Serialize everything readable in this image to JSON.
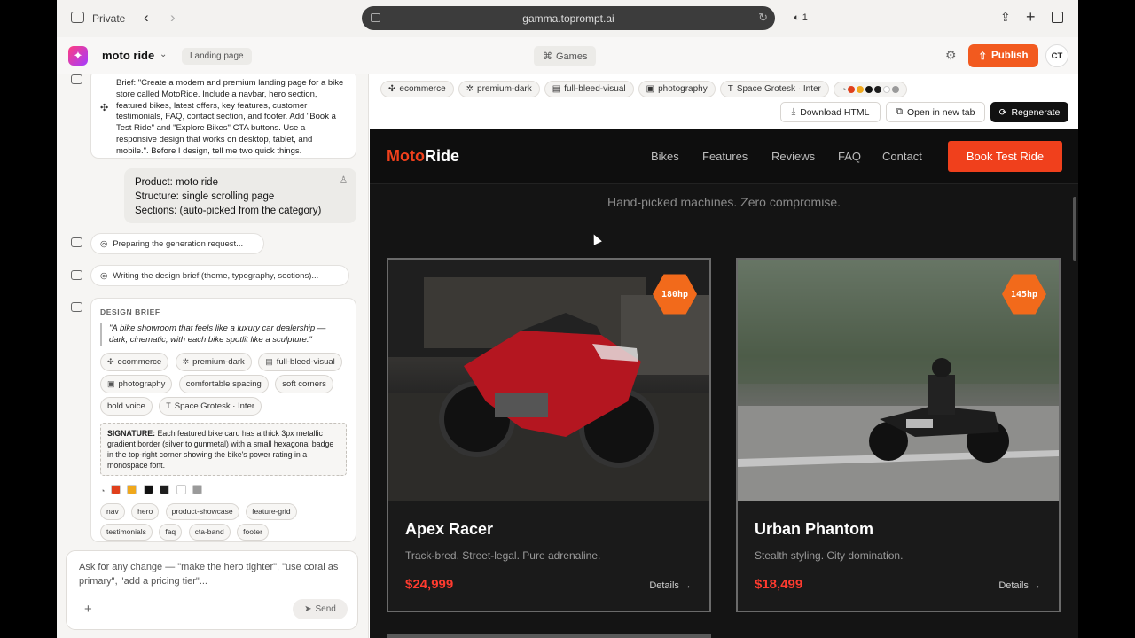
{
  "browser": {
    "mode_label": "Private",
    "url": "gamma.toprompt.ai",
    "tab_count": "1"
  },
  "app": {
    "project_name": "moto ride",
    "page_type": "Landing page",
    "center_tab": "Games",
    "publish_label": "Publish",
    "avatar_initials": "CT"
  },
  "chat": {
    "brief_text": "Brief: \"Create a modern and premium landing page for a bike store called MotoRide. Include a navbar, hero section, featured bikes, latest offers, key features, customer testimonials, FAQ, contact section, and footer. Add \"Book a Test Ride\" and \"Explore Bikes\" CTA buttons. Use a responsive design that works on desktop, tablet, and mobile.\". Before I design, tell me two quick things.",
    "user_reply": [
      "Product: moto ride",
      "Structure: single scrolling page",
      "Sections: (auto-picked from the category)"
    ],
    "status_1": "Preparing the generation request...",
    "status_2": "Writing the design brief (theme, typography, sections)...",
    "design_brief_heading": "DESIGN BRIEF",
    "quote": "\"A bike showroom that feels like a luxury car dealership — dark, cinematic, with each bike spotlit like a sculpture.\"",
    "tags": [
      "ecommerce",
      "premium-dark",
      "full-bleed-visual",
      "photography",
      "comfortable spacing",
      "soft corners",
      "bold voice",
      "Space Grotesk · Inter"
    ],
    "signature_label": "SIGNATURE:",
    "signature_text": "Each featured bike card has a thick 3px metallic gradient border (silver to gunmetal) with a small hexagonal badge in the top-right corner showing the bike's power rating in a monospace font.",
    "palette": [
      "#e0401c",
      "#f0a81c",
      "#111111",
      "#1e1e1e",
      "#ffffff",
      "#9a9a9a"
    ],
    "sections": [
      "nav",
      "hero",
      "product-showcase",
      "feature-grid",
      "testimonials",
      "faq",
      "cta-band",
      "footer"
    ],
    "input_placeholder": "Ask for any change — \"make the hero tighter\", \"use coral as primary\", \"add a pricing tier\"...",
    "send_label": "Send"
  },
  "toolbar": {
    "tags": [
      "ecommerce",
      "premium-dark",
      "full-bleed-visual",
      "photography",
      "Space Grotesk · Inter"
    ],
    "palette": [
      "#e0401c",
      "#f0a81c",
      "#111111",
      "#1e1e1e",
      "#ffffff",
      "#9a9a9a"
    ],
    "download_label": "Download HTML",
    "open_tab_label": "Open in new tab",
    "regenerate_label": "Regenerate"
  },
  "site": {
    "brand_part1": "Moto",
    "brand_part2": "Ride",
    "nav": [
      "Bikes",
      "Features",
      "Reviews",
      "FAQ",
      "Contact"
    ],
    "cta": "Book Test Ride",
    "tagline": "Hand-picked machines. Zero compromise.",
    "bikes": [
      {
        "name": "Apex Racer",
        "desc": "Track-bred. Street-legal. Pure adrenaline.",
        "price": "$24,999",
        "power": "180hp",
        "details": "Details"
      },
      {
        "name": "Urban Phantom",
        "desc": "Stealth styling. City domination.",
        "price": "$18,499",
        "power": "145hp",
        "details": "Details"
      }
    ]
  }
}
